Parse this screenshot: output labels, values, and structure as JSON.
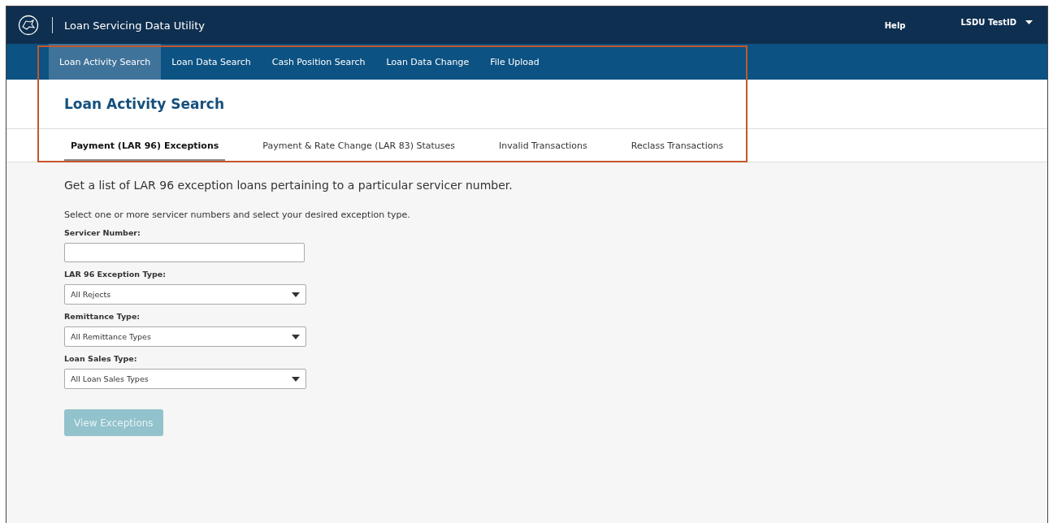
{
  "header": {
    "title": "Loan Servicing Data Utility",
    "help": "Help",
    "user": "LSDU TestID"
  },
  "nav": [
    {
      "label": "Loan Activity Search",
      "selected": true
    },
    {
      "label": "Loan Data Search",
      "selected": false
    },
    {
      "label": "Cash Position Search",
      "selected": false
    },
    {
      "label": "Loan Data Change",
      "selected": false
    },
    {
      "label": "File Upload",
      "selected": false
    }
  ],
  "page_title": "Loan Activity Search",
  "subtabs": [
    {
      "label": "Payment (LAR 96) Exceptions",
      "selected": true
    },
    {
      "label": "Payment & Rate Change (LAR 83) Statuses",
      "selected": false
    },
    {
      "label": "Invalid Transactions",
      "selected": false
    },
    {
      "label": "Reclass Transactions",
      "selected": false
    }
  ],
  "intro": "Get a list of LAR 96 exception loans pertaining to a particular servicer number.",
  "instructions": "Select one or more servicer numbers and select your desired exception type.",
  "fields": [
    {
      "kind": "text",
      "label": "Servicer Number:"
    },
    {
      "kind": "select",
      "label": "LAR 96 Exception Type:",
      "value": "All Rejects"
    },
    {
      "kind": "select",
      "label": "Remittance Type:",
      "value": "All Remittance Types"
    },
    {
      "kind": "select",
      "label": "Loan Sales Type:",
      "value": "All Loan Sales Types"
    }
  ],
  "submit": {
    "label": "View Exceptions",
    "disabled": true
  },
  "highlight": {
    "shown": true
  }
}
